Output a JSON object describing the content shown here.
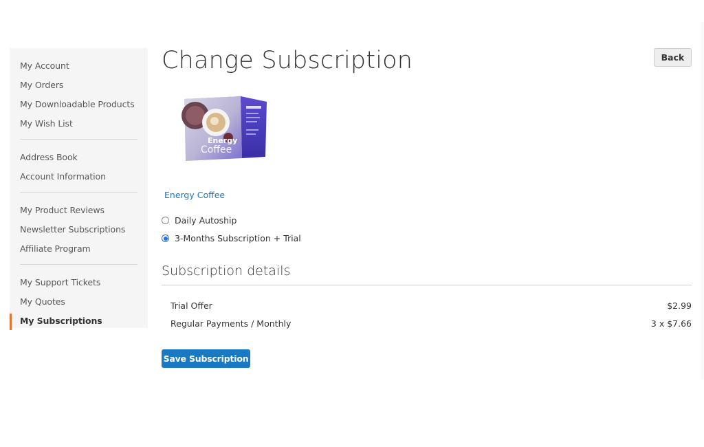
{
  "sidebar": {
    "groups": [
      {
        "items": [
          {
            "label": "My Account"
          },
          {
            "label": "My Orders"
          },
          {
            "label": "My Downloadable Products"
          },
          {
            "label": "My Wish List"
          }
        ]
      },
      {
        "items": [
          {
            "label": "Address Book"
          },
          {
            "label": "Account Information"
          }
        ]
      },
      {
        "items": [
          {
            "label": "My Product Reviews"
          },
          {
            "label": "Newsletter Subscriptions"
          },
          {
            "label": "Affiliate Program"
          }
        ]
      },
      {
        "items": [
          {
            "label": "My Support Tickets"
          },
          {
            "label": "My Quotes"
          },
          {
            "label": "My Subscriptions",
            "active": true
          }
        ]
      }
    ],
    "active_indicator_color": "#e2742e"
  },
  "header": {
    "title": "Change Subscription",
    "back_label": "Back"
  },
  "product": {
    "name": "Energy Coffee",
    "image_text_line1": "Energy",
    "image_text_line2": "Coffee"
  },
  "plans": {
    "options": [
      {
        "label": "Daily Autoship",
        "selected": false
      },
      {
        "label": "3-Months Subscription + Trial",
        "selected": true
      }
    ]
  },
  "details": {
    "title": "Subscription details",
    "rows": [
      {
        "label": "Trial Offer",
        "value": "$2.99"
      },
      {
        "label": "Regular Payments / Monthly",
        "value": "3 x $7.66"
      }
    ]
  },
  "actions": {
    "save_label": "Save Subscription"
  },
  "colors": {
    "link": "#1979c3",
    "primary_button": "#1979c3",
    "sidebar_bg": "#f5f5f5"
  }
}
